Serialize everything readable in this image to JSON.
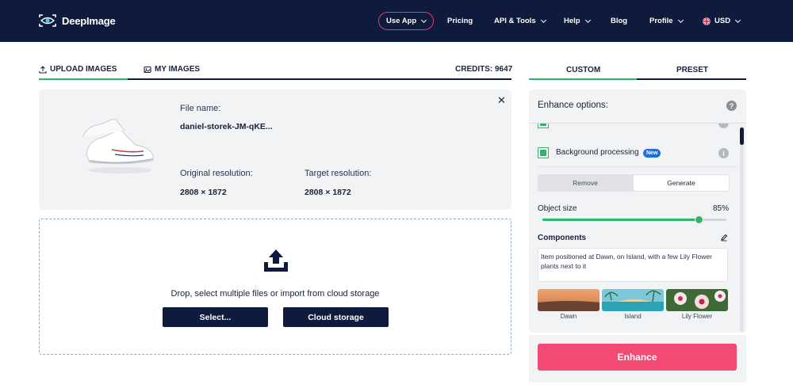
{
  "app": {
    "brand": "DeepImage"
  },
  "nav": {
    "use_app": "Use App",
    "pricing": "Pricing",
    "api_tools": "API & Tools",
    "help": "Help",
    "blog": "Blog",
    "profile": "Profile",
    "currency": "USD"
  },
  "tabs": {
    "upload": "UPLOAD IMAGES",
    "my_images": "MY IMAGES",
    "credits": "CREDITS: 9647"
  },
  "file": {
    "name_label": "File name:",
    "name_value": "daniel-storek-JM-qKE...",
    "orig_label": "Original resolution:",
    "orig_value": "2808 × 1872",
    "target_label": "Target resolution:",
    "target_value": "2808 × 1872",
    "close": "✕"
  },
  "dropzone": {
    "text": "Drop, select multiple files or import from cloud storage",
    "select_button": "Select...",
    "cloud_button": "Cloud storage"
  },
  "panel": {
    "tab_custom": "CUSTOM",
    "tab_preset": "PRESET",
    "title": "Enhance options:",
    "help": "?",
    "bg_processing": "Background processing",
    "new_badge": "New",
    "info": "i",
    "seg_remove": "Remove",
    "seg_generate": "Generate",
    "selected_mode": "Generate",
    "object_size_label": "Object size",
    "object_size_value": "85%",
    "object_size_fraction": 0.85,
    "components_label": "Components",
    "components_text": "Item positioned  at Dawn, on Island, with a few Lily Flower plants next to it",
    "samples": [
      "Dawn",
      "Island",
      "Lily Flower"
    ],
    "enhance_button": "Enhance"
  },
  "colors": {
    "navy": "#0f1b3d",
    "accent_pink": "#f24a73",
    "accent_green": "#2fb46b",
    "badge_blue": "#1d6fe0"
  }
}
